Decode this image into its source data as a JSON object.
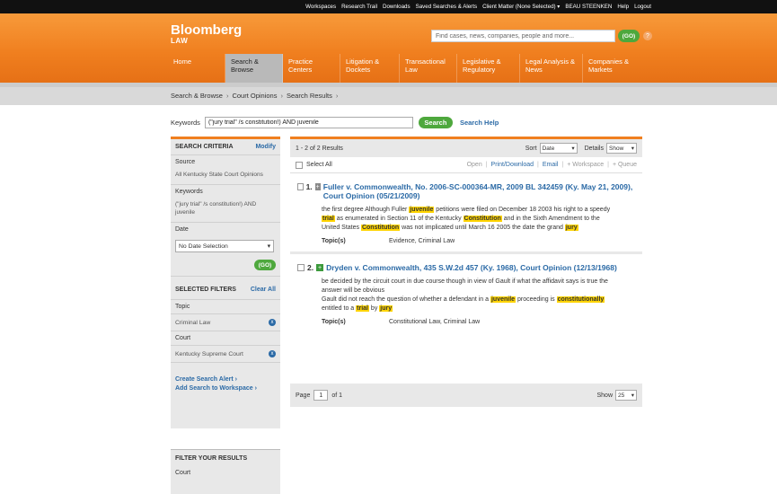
{
  "topbar": {
    "links": [
      "Workspaces",
      "Research Trail",
      "Downloads",
      "Saved Searches & Alerts",
      "Client Matter (None Selected) ▾",
      "BEAU STEENKEN",
      "Help",
      "Logout"
    ]
  },
  "header": {
    "brand": "Bloomberg",
    "brand_sub": "LAW",
    "search_placeholder": "Find cases, news, companies, people and more...",
    "go_label": "(GO)",
    "help_glyph": "?",
    "nav": [
      {
        "line1": "Home",
        "line2": ""
      },
      {
        "line1": "Search &",
        "line2": "Browse"
      },
      {
        "line1": "Practice",
        "line2": "Centers"
      },
      {
        "line1": "Litigation &",
        "line2": "Dockets"
      },
      {
        "line1": "Transactional",
        "line2": "Law"
      },
      {
        "line1": "Legislative &",
        "line2": "Regulatory"
      },
      {
        "line1": "Legal Analysis &",
        "line2": "News"
      },
      {
        "line1": "Companies &",
        "line2": "Markets"
      }
    ]
  },
  "breadcrumb": {
    "items": [
      "Search & Browse",
      "Court Opinions",
      "Search Results"
    ],
    "sep": "›"
  },
  "keywords": {
    "label": "Keywords",
    "value": "(\"jury trial\" /s constitution!) AND juvenile",
    "search_label": "Search",
    "help_label": "Search Help"
  },
  "sidebar": {
    "criteria_title": "SEARCH CRITERIA",
    "modify": "Modify",
    "source_label": "Source",
    "source_value": "All Kentucky State Court Opinions",
    "keywords_label": "Keywords",
    "keywords_value": "(\"jury trial\" /s constitution!) AND juvenile",
    "date_label": "Date",
    "date_select": "No Date Selection",
    "go_label": "(GO)",
    "filters_title": "SELECTED FILTERS",
    "clear_all": "Clear All",
    "topic_label": "Topic",
    "topic_value": "Criminal Law",
    "court_label": "Court",
    "court_value": "Kentucky Supreme Court",
    "remove_glyph": "x",
    "create_alert": "Create Search Alert ›",
    "add_workspace": "Add Search to Workspace ›"
  },
  "filter_panel": {
    "title": "FILTER YOUR RESULTS",
    "court_label": "Court"
  },
  "results": {
    "count": "1 - 2 of 2 Results",
    "sort_label": "Sort",
    "sort_value": "Date",
    "details_label": "Details",
    "details_value": "Show",
    "select_all": "Select All",
    "tools": {
      "open": "Open",
      "print": "Print/Download",
      "email": "Email",
      "workspace": "+ Workspace",
      "queue": "+ Queue"
    },
    "items": [
      {
        "num": "1.",
        "title": "Fuller v. Commonwealth, No. 2006-SC-000364-MR, 2009 BL 342459 (Ky. May 21, 2009), Court Opinion (05/21/2009)",
        "snippet": {
          "a": "the first degree Although Fuller ",
          "b": "juvenile",
          "c": " petitions were filed on December 18 2003 his right to a speedy ",
          "d": "trial",
          "e": " as enumerated in Section 11 of the Kentucky ",
          "f": "Constitution",
          "g": " and in the Sixth Amendment to the United States ",
          "h": "Constitution",
          "i": " was not implicated until March 16 2005 the date the grand ",
          "j": "jury"
        },
        "topics_label": "Topic(s)",
        "topics_value": "Evidence, Criminal Law"
      },
      {
        "num": "2.",
        "title": "Dryden v. Commonwealth, 435 S.W.2d 457 (Ky. 1968), Court Opinion (12/13/1968)",
        "snippet": {
          "a": "be decided by the circuit court in due course though in view of Gault if what the affidavit says is true the answer will be obvious",
          "b": "Gault did not reach the question of whether a defendant in a ",
          "c": "juvenile",
          "d": " proceeding is ",
          "e": "constitutionally",
          "f": " entitled to a ",
          "g": "trial",
          "h": " by ",
          "i": "jury"
        },
        "topics_label": "Topic(s)",
        "topics_value": "Constitutional Law, Criminal Law"
      }
    ],
    "pager": {
      "page_label": "Page",
      "page_value": "1",
      "of_label": "of 1",
      "show_label": "Show",
      "show_value": "25"
    }
  }
}
